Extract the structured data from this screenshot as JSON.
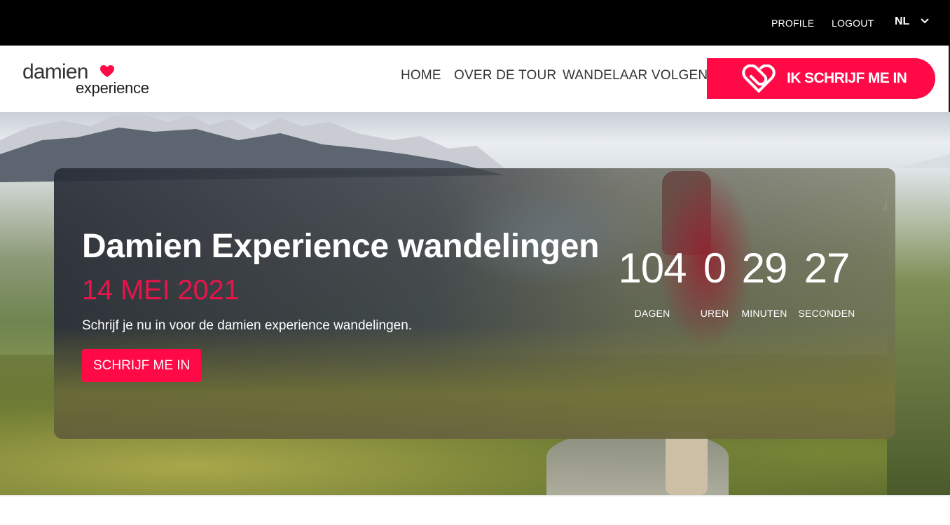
{
  "topbar": {
    "profile_label": "PROFILE",
    "logout_label": "LOGOUT",
    "language": "NL"
  },
  "brand": {
    "line1": "damien",
    "line2": "experience",
    "accent_color": "#ff0a47"
  },
  "nav": {
    "items": [
      {
        "label": "HOME"
      },
      {
        "label": "OVER DE TOUR"
      },
      {
        "label": "WANDELAAR VOLGEN"
      }
    ],
    "cta_label": "IK SCHRIJF ME IN",
    "cta_icon": "paperclip-heart-icon"
  },
  "hero": {
    "title": "Damien Experience wandelingen",
    "date": "14 MEI 2021",
    "subtitle": "Schrijf je nu in voor de damien experience wandelingen.",
    "button_label": "SCHRIJF ME IN",
    "date_color": "#e8144a"
  },
  "countdown": [
    {
      "value": "104",
      "label": "DAGEN"
    },
    {
      "value": "0",
      "label": "UREN"
    },
    {
      "value": "29",
      "label": "MINUTEN"
    },
    {
      "value": "27",
      "label": "SECONDEN"
    }
  ]
}
